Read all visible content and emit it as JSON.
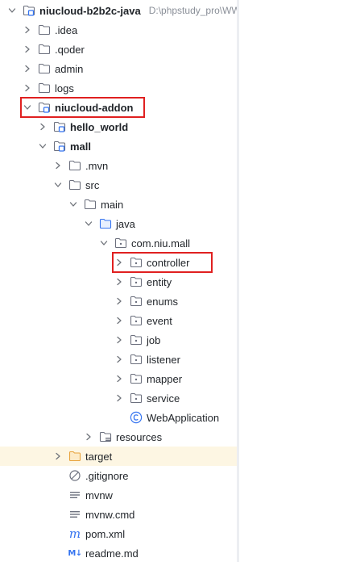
{
  "project_tree": {
    "items": [
      {
        "label": "niucloud-b2b2c-java",
        "path": "D:\\phpstudy_pro\\WWW",
        "depth": 0,
        "expanded": true,
        "icon": "module-folder-icon",
        "bold": true
      },
      {
        "label": ".idea",
        "depth": 1,
        "expanded": false,
        "icon": "folder-icon"
      },
      {
        "label": ".qoder",
        "depth": 1,
        "expanded": false,
        "icon": "folder-icon"
      },
      {
        "label": "admin",
        "depth": 1,
        "expanded": false,
        "icon": "folder-icon"
      },
      {
        "label": "logs",
        "depth": 1,
        "expanded": false,
        "icon": "folder-icon"
      },
      {
        "label": "niucloud-addon",
        "depth": 1,
        "expanded": true,
        "icon": "module-folder-icon",
        "bold": true,
        "highlighted": true
      },
      {
        "label": "hello_world",
        "depth": 2,
        "expanded": false,
        "icon": "module-folder-icon",
        "bold": true
      },
      {
        "label": "mall",
        "depth": 2,
        "expanded": true,
        "icon": "module-folder-icon",
        "bold": true
      },
      {
        "label": ".mvn",
        "depth": 3,
        "expanded": false,
        "icon": "folder-icon"
      },
      {
        "label": "src",
        "depth": 3,
        "expanded": true,
        "icon": "folder-icon"
      },
      {
        "label": "main",
        "depth": 4,
        "expanded": true,
        "icon": "folder-icon"
      },
      {
        "label": "java",
        "depth": 5,
        "expanded": true,
        "icon": "source-root-icon"
      },
      {
        "label": "com.niu.mall",
        "depth": 6,
        "expanded": true,
        "icon": "package-icon"
      },
      {
        "label": "controller",
        "depth": 7,
        "expanded": false,
        "icon": "package-icon",
        "highlighted": true
      },
      {
        "label": "entity",
        "depth": 7,
        "expanded": false,
        "icon": "package-icon"
      },
      {
        "label": "enums",
        "depth": 7,
        "expanded": false,
        "icon": "package-icon"
      },
      {
        "label": "event",
        "depth": 7,
        "expanded": false,
        "icon": "package-icon"
      },
      {
        "label": "job",
        "depth": 7,
        "expanded": false,
        "icon": "package-icon"
      },
      {
        "label": "listener",
        "depth": 7,
        "expanded": false,
        "icon": "package-icon"
      },
      {
        "label": "mapper",
        "depth": 7,
        "expanded": false,
        "icon": "package-icon"
      },
      {
        "label": "service",
        "depth": 7,
        "expanded": false,
        "icon": "package-icon"
      },
      {
        "label": "WebApplication",
        "depth": 7,
        "expanded": null,
        "icon": "java-class-icon"
      },
      {
        "label": "resources",
        "depth": 5,
        "expanded": false,
        "icon": "resources-root-icon"
      },
      {
        "label": "target",
        "depth": 3,
        "expanded": false,
        "icon": "excluded-folder-icon",
        "excluded": true
      },
      {
        "label": ".gitignore",
        "depth": 3,
        "expanded": null,
        "icon": "ignore-file-icon"
      },
      {
        "label": "mvnw",
        "depth": 3,
        "expanded": null,
        "icon": "text-file-icon"
      },
      {
        "label": "mvnw.cmd",
        "depth": 3,
        "expanded": null,
        "icon": "text-file-icon"
      },
      {
        "label": "pom.xml",
        "depth": 3,
        "expanded": null,
        "icon": "maven-icon",
        "glyph": "m"
      },
      {
        "label": "readme.md",
        "depth": 3,
        "expanded": null,
        "icon": "markdown-icon",
        "glyph": "M↓"
      }
    ]
  },
  "colors": {
    "chevron": "#6f737a",
    "folder_stroke": "#6c707e",
    "module_accent": "#3574f0",
    "excluded_folder": "#e8a33d",
    "excluded_row_bg": "#fdf6e3",
    "highlight_box": "#e02020",
    "path_text": "#8a8f98"
  }
}
